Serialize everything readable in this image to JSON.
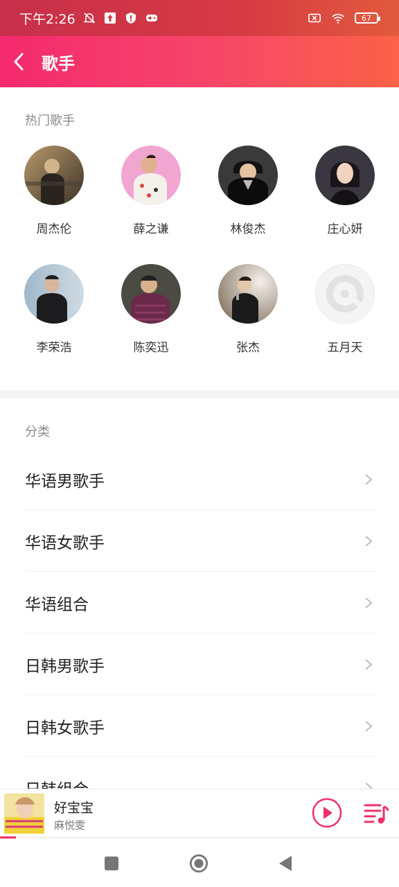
{
  "status_bar": {
    "time": "下午2:26",
    "battery": "67"
  },
  "header": {
    "title": "歌手"
  },
  "hot_singers": {
    "label": "热门歌手",
    "artists": [
      {
        "name": "周杰伦"
      },
      {
        "name": "薛之谦"
      },
      {
        "name": "林俊杰"
      },
      {
        "name": "庄心妍"
      },
      {
        "name": "李荣浩"
      },
      {
        "name": "陈奕迅"
      },
      {
        "name": "张杰"
      },
      {
        "name": "五月天"
      }
    ]
  },
  "categories": {
    "label": "分类",
    "items": [
      {
        "label": "华语男歌手"
      },
      {
        "label": "华语女歌手"
      },
      {
        "label": "华语组合"
      },
      {
        "label": "日韩男歌手"
      },
      {
        "label": "日韩女歌手"
      },
      {
        "label": "日韩组合"
      }
    ]
  },
  "player": {
    "title": "好宝宝",
    "artist": "麻悦雯",
    "progress": 0.04
  },
  "colors": {
    "accent": "#f0306a",
    "header_start": "#f42a6e",
    "header_end": "#fb6246"
  }
}
